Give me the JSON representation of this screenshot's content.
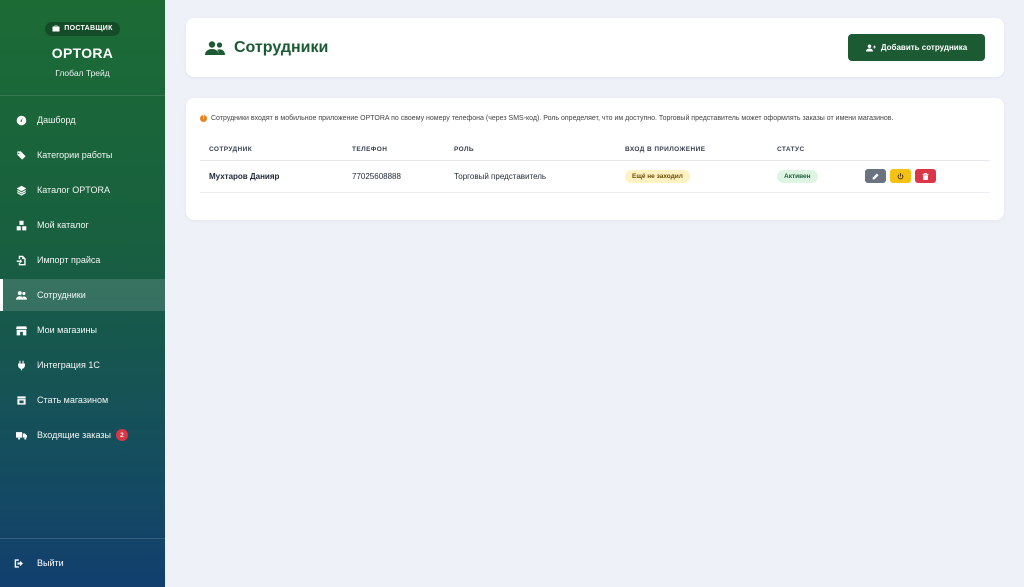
{
  "sidebar": {
    "role_badge": "ПОСТАВЩИК",
    "brand": "OPTORA",
    "company": "Глобал Трейд",
    "items": [
      {
        "label": "Дашборд",
        "icon": "gauge-icon"
      },
      {
        "label": "Категории работы",
        "icon": "tags-icon"
      },
      {
        "label": "Каталог OPTORA",
        "icon": "layers-icon"
      },
      {
        "label": "Мой каталог",
        "icon": "boxes-icon"
      },
      {
        "label": "Импорт прайса",
        "icon": "file-import-icon"
      },
      {
        "label": "Сотрудники",
        "icon": "users-icon",
        "active": true
      },
      {
        "label": "Мои магазины",
        "icon": "store-icon"
      },
      {
        "label": "Интеграция 1С",
        "icon": "plug-icon"
      },
      {
        "label": "Стать магазином",
        "icon": "shop-icon"
      },
      {
        "label": "Входящие заказы",
        "icon": "truck-icon",
        "badge": "2"
      }
    ],
    "logout": "Выйти"
  },
  "header": {
    "title": "Сотрудники",
    "add_button": "Добавить сотрудника"
  },
  "content": {
    "info": "Сотрудники входят в мобильное приложение OPTORA по своему номеру телефона (через SMS-код). Роль определяет, что им доступно. Торговый представитель может оформлять заказы от имени магазинов.",
    "columns": [
      "СОТРУДНИК",
      "ТЕЛЕФОН",
      "РОЛЬ",
      "ВХОД В ПРИЛОЖЕНИЕ",
      "СТАТУС"
    ],
    "rows": [
      {
        "name": "Мухтаров Данияр",
        "phone": "77025608888",
        "role": "Торговый представитель",
        "login": "Ещё не заходил",
        "status": "Активен"
      }
    ]
  },
  "colors": {
    "accent": "#1c5a33",
    "warning": "#f5c213",
    "danger": "#dc3545",
    "success_bg": "#dff5e4"
  }
}
